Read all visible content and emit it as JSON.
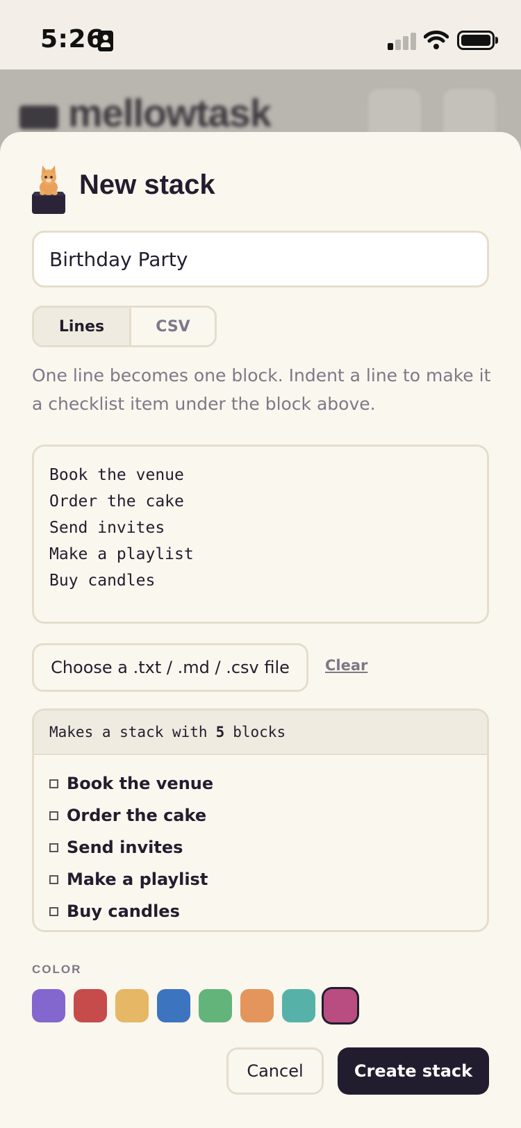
{
  "status_bar": {
    "time": "5:26"
  },
  "background_app": {
    "brand": "mellowtask"
  },
  "dialog": {
    "title": "New stack",
    "name_value": "Birthday Party",
    "tabs": [
      {
        "label": "Lines",
        "active": true
      },
      {
        "label": "CSV",
        "active": false
      }
    ],
    "help_text": "One line becomes one block. Indent a line to make it a checklist item under the block above.",
    "textarea_value": "Book the venue\nOrder the cake\nSend invites\nMake a playlist\nBuy candles",
    "file_button_label": "Choose a .txt / .md / .csv file",
    "clear_label": "Clear",
    "preview": {
      "prefix": "Makes a stack with",
      "count": "5",
      "suffix": "blocks",
      "items": [
        "Book the venue",
        "Order the cake",
        "Send invites",
        "Make a playlist",
        "Buy candles"
      ]
    },
    "color_label": "COLOR",
    "colors": [
      "#8466cf",
      "#c64b4b",
      "#e6b765",
      "#3c74bf",
      "#63b47a",
      "#e3955b",
      "#56b2a8",
      "#b94d80"
    ],
    "selected_color_index": 7,
    "cancel_label": "Cancel",
    "create_label": "Create stack"
  },
  "icons": [
    "id-card-icon",
    "signal-icon",
    "wifi-icon",
    "battery-icon",
    "cat-mascot-icon"
  ]
}
